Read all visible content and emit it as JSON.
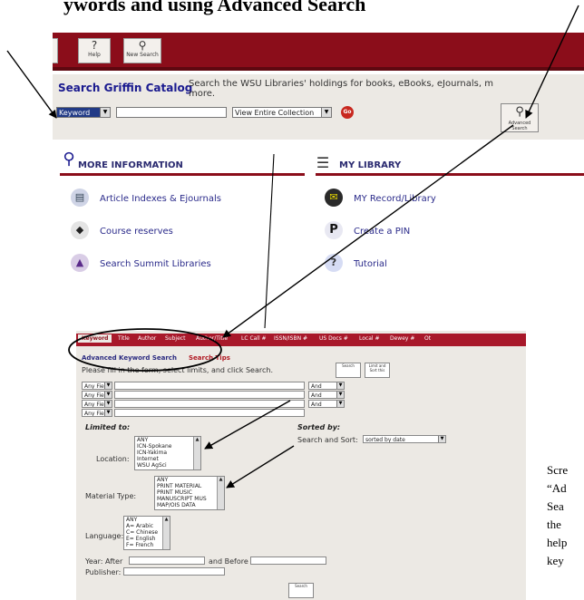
{
  "doc_heading": "ywords and using Advanced Search",
  "catalog": {
    "toolbar": [
      {
        "label": "Help",
        "icon": "question-mark-icon"
      },
      {
        "label": "New Search",
        "icon": "magnifier-x-icon"
      }
    ],
    "title": "Search Griffin Catalog",
    "description_line1": "Search the WSU Libraries' holdings for books, eBooks, eJournals, m",
    "description_line2": "more.",
    "search_type": "Keyword",
    "search_query": "",
    "collection": "View Entire Collection",
    "go_label": "Go",
    "advanced_search_label": "Advanced Search"
  },
  "more_info": {
    "title": "MORE INFORMATION",
    "items": [
      "Article Indexes & Ejournals",
      "Course reserves",
      "Search Summit Libraries"
    ]
  },
  "my_library": {
    "title": "MY LIBRARY",
    "items": [
      "MY Record/Library",
      "Create a PIN",
      "Tutorial"
    ]
  },
  "advanced": {
    "tabs": [
      "Keyword",
      "Title",
      "Author",
      "Subject",
      "Author/Title",
      "LC Call #",
      "ISSN/ISBN #",
      "US Docs #",
      "Local #",
      "Dewey #",
      "Ot"
    ],
    "title": "Advanced Keyword Search",
    "tips": "Search Tips",
    "instructions": "Please fill in the form, select limits, and click Search.",
    "search_button": "Search",
    "limit_button": "Limit and Sort this",
    "field_rows": [
      {
        "field": "Any Field",
        "op": "And"
      },
      {
        "field": "Any Field",
        "op": "And"
      },
      {
        "field": "Any Field",
        "op": "And"
      },
      {
        "field": "Any Field",
        "op": ""
      }
    ],
    "limited_to": "Limited to:",
    "sorted_by": "Sorted by:",
    "search_sort_label": "Search and Sort:",
    "sort_value": "sorted by date",
    "location_label": "Location:",
    "location_options": [
      "ANY",
      "ICN-Spokane",
      "ICN-Yakima",
      "Internet",
      "WSU AgSci"
    ],
    "material_label": "Material Type:",
    "material_options": [
      "ANY",
      "PRINT MATERIAL",
      "PRINT MUSIC",
      "MANUSCRIPT MUS",
      "MAP/OIS DATA"
    ],
    "language_label": "Language:",
    "language_options": [
      "ANY",
      "A= Arabic",
      "C= Chinese",
      "E= English",
      "F= French"
    ],
    "year_after": "Year: After",
    "and_before": "and Before",
    "publisher": "Publisher:",
    "bottom_search": "Search"
  },
  "side_note": [
    "Scre",
    "“Ad",
    "Sea",
    "the",
    "help",
    "key"
  ]
}
